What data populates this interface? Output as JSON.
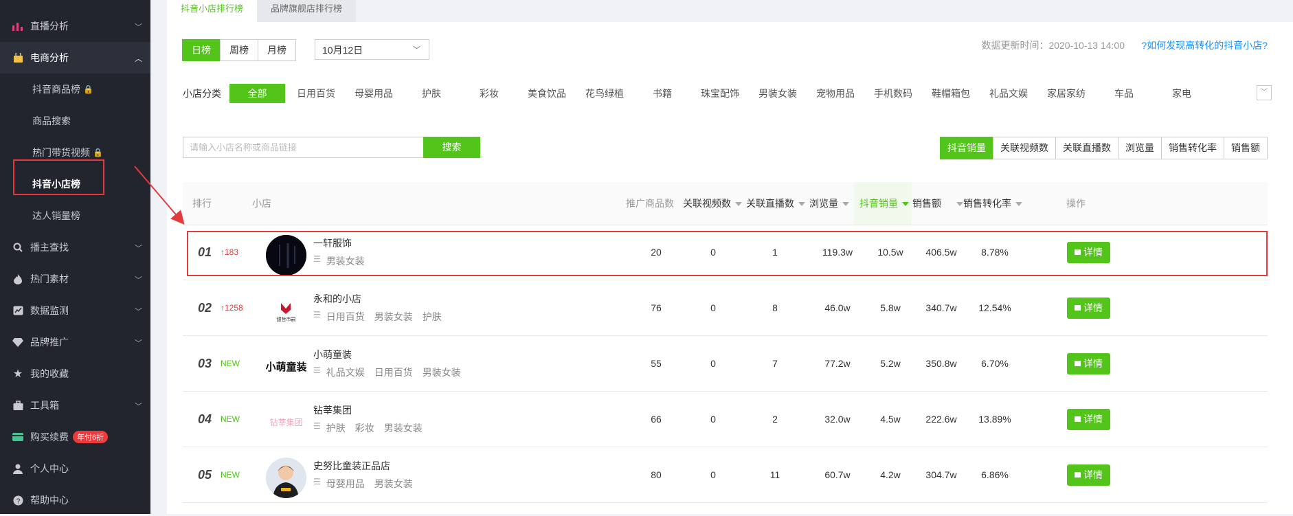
{
  "sidebar": {
    "items": [
      {
        "label": "直播分析",
        "icon": "bar-chart-icon"
      },
      {
        "label": "电商分析",
        "icon": "shopping-bag-icon"
      },
      {
        "label": "播主查找",
        "icon": "search-icon"
      },
      {
        "label": "热门素材",
        "icon": "fire-icon"
      },
      {
        "label": "数据监测",
        "icon": "monitor-icon"
      },
      {
        "label": "品牌推广",
        "icon": "diamond-icon"
      },
      {
        "label": "我的收藏",
        "icon": "star-icon"
      },
      {
        "label": "工具箱",
        "icon": "toolbox-icon"
      },
      {
        "label": "购买续费",
        "icon": "card-icon",
        "badge": "年付6折"
      },
      {
        "label": "个人中心",
        "icon": "user-icon"
      },
      {
        "label": "帮助中心",
        "icon": "help-icon"
      }
    ],
    "sub_items": [
      {
        "label": "抖音商品榜",
        "locked": true
      },
      {
        "label": "商品搜索",
        "locked": false
      },
      {
        "label": "热门带货视频",
        "locked": true
      },
      {
        "label": "抖音小店榜",
        "locked": false
      },
      {
        "label": "达人销量榜",
        "locked": false
      }
    ]
  },
  "tabs": [
    "抖音小店排行榜",
    "品牌旗舰店排行榜"
  ],
  "period": {
    "options": [
      "日榜",
      "周榜",
      "月榜"
    ],
    "selected": "日榜"
  },
  "date": "10月12日",
  "update_time": "数据更新时间：2020-10-13 14:00",
  "help_link": "?如何发现高转化的抖音小店?",
  "category_label": "小店分类",
  "categories": [
    "全部",
    "日用百货",
    "母婴用品",
    "护肤",
    "彩妆",
    "美食饮品",
    "花鸟绿植",
    "书籍",
    "珠宝配饰",
    "男装女装",
    "宠物用品",
    "手机数码",
    "鞋帽箱包",
    "礼品文娱",
    "家居家纺",
    "车品",
    "家电"
  ],
  "search": {
    "placeholder": "请输入小店名称或商品链接",
    "button": "搜索"
  },
  "sort_tabs": [
    "抖音销量",
    "关联视频数",
    "关联直播数",
    "浏览量",
    "销售转化率",
    "销售额"
  ],
  "table": {
    "headers": {
      "rank": "排行",
      "shop": "小店",
      "products": "推广商品数",
      "videos": "关联视频数",
      "lives": "关联直播数",
      "views": "浏览量",
      "sales": "抖音销量",
      "revenue": "销售额",
      "conversion": "销售转化率",
      "action": "操作"
    },
    "rows": [
      {
        "rank": "01",
        "change": "↑183",
        "name": "一轩服饰",
        "cats": [
          "男装女装"
        ],
        "products": "20",
        "videos": "0",
        "lives": "1",
        "views": "119.3w",
        "sales": "10.5w",
        "revenue": "406.5w",
        "conversion": "8.78%",
        "button": "详情"
      },
      {
        "rank": "02",
        "change": "↑1258",
        "name": "永和的小店",
        "cats": [
          "日用百货",
          "男装女装",
          "护肤"
        ],
        "products": "76",
        "videos": "0",
        "lives": "8",
        "views": "46.0w",
        "sales": "5.8w",
        "revenue": "340.7w",
        "conversion": "12.54%",
        "button": "详情"
      },
      {
        "rank": "03",
        "change": "NEW",
        "name": "小萌童装",
        "cats": [
          "礼品文娱",
          "日用百货",
          "男装女装"
        ],
        "products": "55",
        "videos": "0",
        "lives": "7",
        "views": "77.2w",
        "sales": "5.2w",
        "revenue": "350.8w",
        "conversion": "6.70%",
        "button": "详情"
      },
      {
        "rank": "04",
        "change": "NEW",
        "name": "钻莘集团",
        "cats": [
          "护肤",
          "彩妆",
          "男装女装"
        ],
        "products": "66",
        "videos": "0",
        "lives": "2",
        "views": "32.0w",
        "sales": "4.5w",
        "revenue": "222.6w",
        "conversion": "13.89%",
        "button": "详情"
      },
      {
        "rank": "05",
        "change": "NEW",
        "name": "史努比童装正品店",
        "cats": [
          "母婴用品",
          "男装女装"
        ],
        "products": "80",
        "videos": "0",
        "lives": "11",
        "views": "60.7w",
        "sales": "4.2w",
        "revenue": "304.7w",
        "conversion": "6.86%",
        "button": "详情"
      }
    ]
  },
  "logos": {
    "row2": "甜哲市嗣",
    "row3": "小萌童装",
    "row4": "钻莘集团"
  },
  "colors": {
    "accent": "#52c41a",
    "sidebar_bg": "#22252e",
    "highlight": "#e33b3b",
    "link": "#1890ff"
  }
}
